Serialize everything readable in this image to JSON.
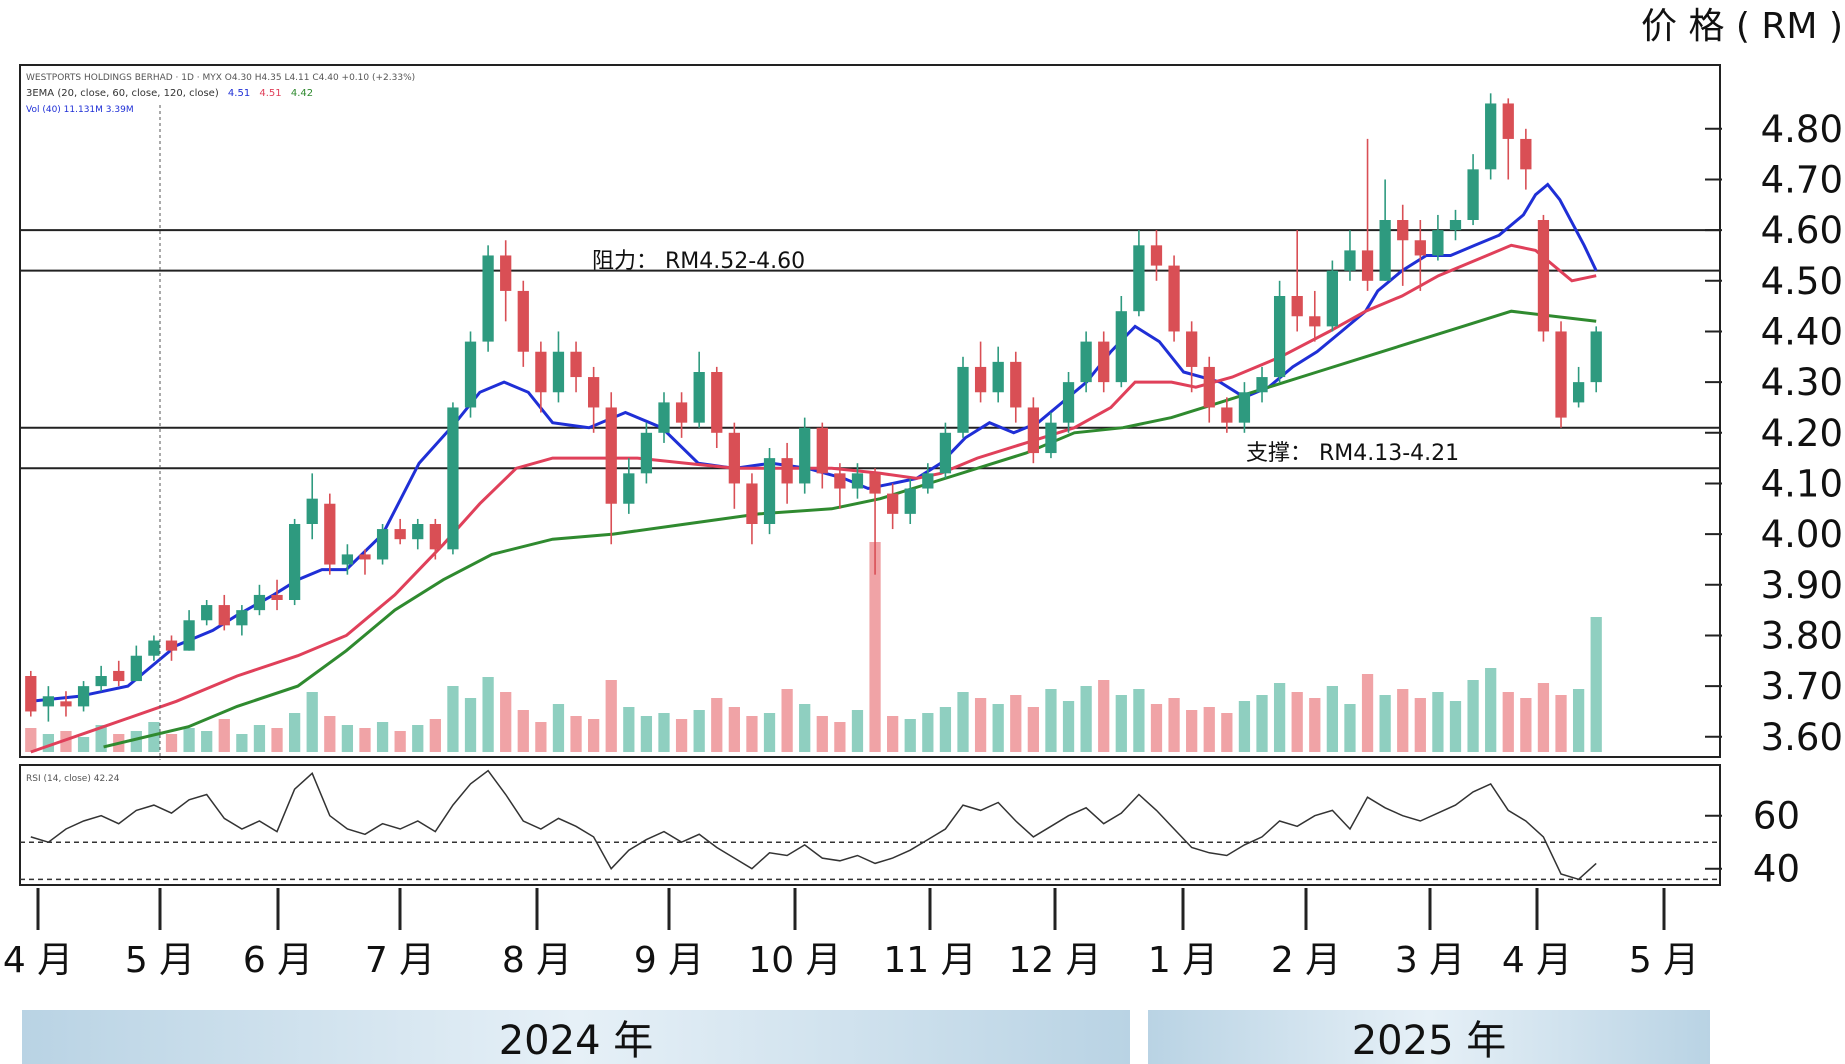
{
  "chart_data": {
    "type": "candlestick",
    "y_axis_title": "价 格 ( RM )",
    "price_ticks": [
      "4.80",
      "4.70",
      "4.60",
      "4.50",
      "4.40",
      "4.30",
      "4.20",
      "4.10",
      "4.00",
      "3.90",
      "3.80",
      "3.70",
      "3.60"
    ],
    "price_range": [
      3.57,
      4.92
    ],
    "rsi_ticks": [
      "60",
      "40"
    ],
    "rsi_range": [
      35,
      78
    ],
    "rsi_dashed_levels": [
      50,
      36
    ],
    "month_labels": [
      "4 月",
      "5 月",
      "6 月",
      "7 月",
      "8 月",
      "9 月",
      "10 月",
      "11 月",
      "12 月",
      "1 月",
      "2 月",
      "3 月",
      "4 月",
      "5 月"
    ],
    "year_bands": [
      "2024 年",
      "2025 年"
    ],
    "header_line_1": "WESTPORTS HOLDINGS BERHAD · 1D · MYX  O4.30  H4.35  L4.11  C4.40  +0.10 (+2.33%)",
    "header_line_2_prefix": "3EMA (20, close, 60, close, 120, close)",
    "header_line_2_values": [
      "4.51",
      "4.51",
      "4.42"
    ],
    "header_line_3": "Vol (40)  11.131M  3.39M",
    "rsi_header": "RSI (14, close)  42.24",
    "resistance": {
      "label": "阻力：  RM4.52-4.60",
      "low": 4.52,
      "high": 4.6
    },
    "support": {
      "label": "支撑：  RM4.13-4.21",
      "low": 4.13,
      "high": 4.21
    },
    "series": [
      {
        "role": "ema-fast",
        "color": "#1f2fd6",
        "points": [
          [
            3.67,
            0
          ],
          [
            3.68,
            20
          ],
          [
            3.7,
            40
          ],
          [
            3.74,
            50
          ],
          [
            3.78,
            60
          ],
          [
            3.81,
            75
          ],
          [
            3.84,
            85
          ],
          [
            3.88,
            100
          ],
          [
            3.91,
            110
          ],
          [
            3.93,
            120
          ],
          [
            3.93,
            130
          ],
          [
            4.0,
            145
          ],
          [
            4.14,
            160
          ],
          [
            4.22,
            175
          ],
          [
            4.28,
            185
          ],
          [
            4.3,
            195
          ],
          [
            4.28,
            205
          ],
          [
            4.22,
            215
          ],
          [
            4.21,
            230
          ],
          [
            4.24,
            245
          ],
          [
            4.21,
            260
          ],
          [
            4.14,
            275
          ],
          [
            4.13,
            290
          ],
          [
            4.14,
            305
          ],
          [
            4.13,
            320
          ],
          [
            4.11,
            335
          ],
          [
            4.09,
            345
          ],
          [
            4.1,
            355
          ],
          [
            4.11,
            365
          ],
          [
            4.14,
            375
          ],
          [
            4.19,
            385
          ],
          [
            4.22,
            395
          ],
          [
            4.2,
            405
          ],
          [
            4.22,
            415
          ],
          [
            4.26,
            425
          ],
          [
            4.3,
            435
          ],
          [
            4.36,
            445
          ],
          [
            4.41,
            455
          ],
          [
            4.38,
            465
          ],
          [
            4.32,
            475
          ],
          [
            4.3,
            490
          ],
          [
            4.27,
            500
          ],
          [
            4.29,
            510
          ],
          [
            4.33,
            520
          ],
          [
            4.36,
            530
          ],
          [
            4.4,
            540
          ],
          [
            4.44,
            550
          ],
          [
            4.48,
            555
          ],
          [
            4.52,
            565
          ],
          [
            4.55,
            575
          ],
          [
            4.55,
            585
          ],
          [
            4.57,
            595
          ],
          [
            4.59,
            605
          ],
          [
            4.63,
            615
          ],
          [
            4.67,
            620
          ],
          [
            4.69,
            625
          ],
          [
            4.66,
            630
          ],
          [
            4.57,
            640
          ],
          [
            4.52,
            645
          ]
        ]
      },
      {
        "role": "ema-mid",
        "color": "#e0405a",
        "points": [
          [
            3.57,
            0
          ],
          [
            3.62,
            30
          ],
          [
            3.67,
            60
          ],
          [
            3.72,
            85
          ],
          [
            3.76,
            110
          ],
          [
            3.8,
            130
          ],
          [
            3.88,
            150
          ],
          [
            3.98,
            170
          ],
          [
            4.06,
            185
          ],
          [
            4.13,
            200
          ],
          [
            4.15,
            215
          ],
          [
            4.15,
            230
          ],
          [
            4.15,
            250
          ],
          [
            4.14,
            270
          ],
          [
            4.13,
            290
          ],
          [
            4.13,
            310
          ],
          [
            4.13,
            330
          ],
          [
            4.12,
            350
          ],
          [
            4.11,
            365
          ],
          [
            4.12,
            375
          ],
          [
            4.15,
            390
          ],
          [
            4.18,
            410
          ],
          [
            4.21,
            430
          ],
          [
            4.25,
            445
          ],
          [
            4.3,
            455
          ],
          [
            4.3,
            470
          ],
          [
            4.29,
            480
          ],
          [
            4.31,
            495
          ],
          [
            4.35,
            515
          ],
          [
            4.4,
            535
          ],
          [
            4.44,
            550
          ],
          [
            4.47,
            565
          ],
          [
            4.51,
            580
          ],
          [
            4.55,
            600
          ],
          [
            4.57,
            610
          ],
          [
            4.56,
            620
          ],
          [
            4.5,
            635
          ],
          [
            4.51,
            645
          ]
        ]
      },
      {
        "role": "ema-slow",
        "color": "#2f8a2f",
        "points": [
          [
            3.58,
            30
          ],
          [
            3.62,
            65
          ],
          [
            3.66,
            85
          ],
          [
            3.7,
            110
          ],
          [
            3.77,
            130
          ],
          [
            3.85,
            150
          ],
          [
            3.91,
            170
          ],
          [
            3.96,
            190
          ],
          [
            3.99,
            215
          ],
          [
            4.0,
            240
          ],
          [
            4.02,
            270
          ],
          [
            4.04,
            300
          ],
          [
            4.05,
            330
          ],
          [
            4.07,
            350
          ],
          [
            4.1,
            370
          ],
          [
            4.13,
            390
          ],
          [
            4.16,
            410
          ],
          [
            4.2,
            430
          ],
          [
            4.21,
            450
          ],
          [
            4.23,
            470
          ],
          [
            4.26,
            490
          ],
          [
            4.29,
            510
          ],
          [
            4.32,
            530
          ],
          [
            4.35,
            550
          ],
          [
            4.38,
            570
          ],
          [
            4.41,
            590
          ],
          [
            4.44,
            610
          ],
          [
            4.42,
            645
          ]
        ]
      }
    ],
    "candles": [
      {
        "o": 3.72,
        "c": 3.65,
        "h": 3.73,
        "l": 3.64
      },
      {
        "o": 3.66,
        "c": 3.68,
        "h": 3.7,
        "l": 3.63
      },
      {
        "o": 3.67,
        "c": 3.66,
        "h": 3.69,
        "l": 3.64
      },
      {
        "o": 3.66,
        "c": 3.7,
        "h": 3.71,
        "l": 3.65
      },
      {
        "o": 3.7,
        "c": 3.72,
        "h": 3.74,
        "l": 3.69
      },
      {
        "o": 3.73,
        "c": 3.71,
        "h": 3.75,
        "l": 3.7
      },
      {
        "o": 3.71,
        "c": 3.76,
        "h": 3.78,
        "l": 3.71
      },
      {
        "o": 3.76,
        "c": 3.79,
        "h": 3.8,
        "l": 3.75
      },
      {
        "o": 3.79,
        "c": 3.77,
        "h": 3.8,
        "l": 3.75
      },
      {
        "o": 3.77,
        "c": 3.83,
        "h": 3.85,
        "l": 3.77
      },
      {
        "o": 3.83,
        "c": 3.86,
        "h": 3.87,
        "l": 3.82
      },
      {
        "o": 3.86,
        "c": 3.82,
        "h": 3.88,
        "l": 3.81
      },
      {
        "o": 3.82,
        "c": 3.85,
        "h": 3.86,
        "l": 3.8
      },
      {
        "o": 3.85,
        "c": 3.88,
        "h": 3.9,
        "l": 3.84
      },
      {
        "o": 3.88,
        "c": 3.87,
        "h": 3.91,
        "l": 3.85
      },
      {
        "o": 3.87,
        "c": 4.02,
        "h": 4.03,
        "l": 3.86
      },
      {
        "o": 4.02,
        "c": 4.07,
        "h": 4.12,
        "l": 3.99
      },
      {
        "o": 4.06,
        "c": 3.94,
        "h": 4.08,
        "l": 3.92
      },
      {
        "o": 3.94,
        "c": 3.96,
        "h": 3.98,
        "l": 3.92
      },
      {
        "o": 3.96,
        "c": 3.95,
        "h": 3.97,
        "l": 3.92
      },
      {
        "o": 3.95,
        "c": 4.01,
        "h": 4.02,
        "l": 3.94
      },
      {
        "o": 4.01,
        "c": 3.99,
        "h": 4.03,
        "l": 3.98
      },
      {
        "o": 3.99,
        "c": 4.02,
        "h": 4.03,
        "l": 3.97
      },
      {
        "o": 4.02,
        "c": 3.97,
        "h": 4.03,
        "l": 3.95
      },
      {
        "o": 3.97,
        "c": 4.25,
        "h": 4.26,
        "l": 3.96
      },
      {
        "o": 4.25,
        "c": 4.38,
        "h": 4.4,
        "l": 4.23
      },
      {
        "o": 4.38,
        "c": 4.55,
        "h": 4.57,
        "l": 4.36
      },
      {
        "o": 4.55,
        "c": 4.48,
        "h": 4.58,
        "l": 4.42
      },
      {
        "o": 4.48,
        "c": 4.36,
        "h": 4.5,
        "l": 4.33
      },
      {
        "o": 4.36,
        "c": 4.28,
        "h": 4.38,
        "l": 4.24
      },
      {
        "o": 4.28,
        "c": 4.36,
        "h": 4.4,
        "l": 4.26
      },
      {
        "o": 4.36,
        "c": 4.31,
        "h": 4.38,
        "l": 4.28
      },
      {
        "o": 4.31,
        "c": 4.25,
        "h": 4.33,
        "l": 4.2
      },
      {
        "o": 4.25,
        "c": 4.06,
        "h": 4.28,
        "l": 3.98
      },
      {
        "o": 4.06,
        "c": 4.12,
        "h": 4.15,
        "l": 4.04
      },
      {
        "o": 4.12,
        "c": 4.2,
        "h": 4.22,
        "l": 4.1
      },
      {
        "o": 4.2,
        "c": 4.26,
        "h": 4.28,
        "l": 4.18
      },
      {
        "o": 4.26,
        "c": 4.22,
        "h": 4.28,
        "l": 4.19
      },
      {
        "o": 4.22,
        "c": 4.32,
        "h": 4.36,
        "l": 4.21
      },
      {
        "o": 4.32,
        "c": 4.2,
        "h": 4.33,
        "l": 4.17
      },
      {
        "o": 4.2,
        "c": 4.1,
        "h": 4.22,
        "l": 4.05
      },
      {
        "o": 4.1,
        "c": 4.02,
        "h": 4.12,
        "l": 3.98
      },
      {
        "o": 4.02,
        "c": 4.15,
        "h": 4.17,
        "l": 4.0
      },
      {
        "o": 4.15,
        "c": 4.1,
        "h": 4.18,
        "l": 4.06
      },
      {
        "o": 4.1,
        "c": 4.21,
        "h": 4.23,
        "l": 4.08
      },
      {
        "o": 4.21,
        "c": 4.12,
        "h": 4.22,
        "l": 4.09
      },
      {
        "o": 4.12,
        "c": 4.09,
        "h": 4.14,
        "l": 4.05
      },
      {
        "o": 4.09,
        "c": 4.12,
        "h": 4.14,
        "l": 4.07
      },
      {
        "o": 4.12,
        "c": 4.08,
        "h": 4.13,
        "l": 3.92
      },
      {
        "o": 4.08,
        "c": 4.04,
        "h": 4.1,
        "l": 4.01
      },
      {
        "o": 4.04,
        "c": 4.09,
        "h": 4.11,
        "l": 4.02
      },
      {
        "o": 4.09,
        "c": 4.12,
        "h": 4.14,
        "l": 4.08
      },
      {
        "o": 4.12,
        "c": 4.2,
        "h": 4.22,
        "l": 4.11
      },
      {
        "o": 4.2,
        "c": 4.33,
        "h": 4.35,
        "l": 4.19
      },
      {
        "o": 4.33,
        "c": 4.28,
        "h": 4.38,
        "l": 4.26
      },
      {
        "o": 4.28,
        "c": 4.34,
        "h": 4.37,
        "l": 4.26
      },
      {
        "o": 4.34,
        "c": 4.25,
        "h": 4.36,
        "l": 4.22
      },
      {
        "o": 4.25,
        "c": 4.16,
        "h": 4.27,
        "l": 4.14
      },
      {
        "o": 4.16,
        "c": 4.22,
        "h": 4.24,
        "l": 4.15
      },
      {
        "o": 4.22,
        "c": 4.3,
        "h": 4.32,
        "l": 4.2
      },
      {
        "o": 4.3,
        "c": 4.38,
        "h": 4.4,
        "l": 4.28
      },
      {
        "o": 4.38,
        "c": 4.3,
        "h": 4.4,
        "l": 4.28
      },
      {
        "o": 4.3,
        "c": 4.44,
        "h": 4.47,
        "l": 4.29
      },
      {
        "o": 4.44,
        "c": 4.57,
        "h": 4.6,
        "l": 4.43
      },
      {
        "o": 4.57,
        "c": 4.53,
        "h": 4.6,
        "l": 4.5
      },
      {
        "o": 4.53,
        "c": 4.4,
        "h": 4.55,
        "l": 4.38
      },
      {
        "o": 4.4,
        "c": 4.33,
        "h": 4.42,
        "l": 4.28
      },
      {
        "o": 4.33,
        "c": 4.25,
        "h": 4.35,
        "l": 4.22
      },
      {
        "o": 4.25,
        "c": 4.22,
        "h": 4.27,
        "l": 4.2
      },
      {
        "o": 4.22,
        "c": 4.28,
        "h": 4.3,
        "l": 4.2
      },
      {
        "o": 4.28,
        "c": 4.31,
        "h": 4.33,
        "l": 4.26
      },
      {
        "o": 4.31,
        "c": 4.47,
        "h": 4.5,
        "l": 4.3
      },
      {
        "o": 4.47,
        "c": 4.43,
        "h": 4.6,
        "l": 4.4
      },
      {
        "o": 4.43,
        "c": 4.41,
        "h": 4.48,
        "l": 4.38
      },
      {
        "o": 4.41,
        "c": 4.52,
        "h": 4.54,
        "l": 4.4
      },
      {
        "o": 4.52,
        "c": 4.56,
        "h": 4.6,
        "l": 4.5
      },
      {
        "o": 4.56,
        "c": 4.5,
        "h": 4.78,
        "l": 4.48
      },
      {
        "o": 4.5,
        "c": 4.62,
        "h": 4.7,
        "l": 4.5
      },
      {
        "o": 4.62,
        "c": 4.58,
        "h": 4.65,
        "l": 4.49
      },
      {
        "o": 4.58,
        "c": 4.55,
        "h": 4.62,
        "l": 4.48
      },
      {
        "o": 4.55,
        "c": 4.6,
        "h": 4.63,
        "l": 4.54
      },
      {
        "o": 4.6,
        "c": 4.62,
        "h": 4.64,
        "l": 4.58
      },
      {
        "o": 4.62,
        "c": 4.72,
        "h": 4.75,
        "l": 4.61
      },
      {
        "o": 4.72,
        "c": 4.85,
        "h": 4.87,
        "l": 4.7
      },
      {
        "o": 4.85,
        "c": 4.78,
        "h": 4.86,
        "l": 4.7
      },
      {
        "o": 4.78,
        "c": 4.72,
        "h": 4.8,
        "l": 4.68
      },
      {
        "o": 4.62,
        "c": 4.4,
        "h": 4.63,
        "l": 4.38
      },
      {
        "o": 4.4,
        "c": 4.23,
        "h": 4.42,
        "l": 4.21
      },
      {
        "o": 4.26,
        "c": 4.3,
        "h": 4.33,
        "l": 4.25
      },
      {
        "o": 4.3,
        "c": 4.4,
        "h": 4.41,
        "l": 4.28
      }
    ],
    "volume": [
      0.8,
      0.6,
      0.7,
      0.5,
      0.9,
      0.6,
      0.7,
      1.0,
      0.6,
      0.8,
      0.7,
      1.1,
      0.6,
      0.9,
      0.8,
      1.3,
      2.0,
      1.2,
      0.9,
      0.8,
      1.0,
      0.7,
      0.9,
      1.1,
      2.2,
      1.8,
      2.5,
      2.0,
      1.4,
      1.0,
      1.6,
      1.2,
      1.1,
      2.4,
      1.5,
      1.2,
      1.3,
      1.1,
      1.4,
      1.8,
      1.5,
      1.2,
      1.3,
      2.1,
      1.6,
      1.2,
      1.0,
      1.4,
      7.0,
      1.2,
      1.1,
      1.3,
      1.5,
      2.0,
      1.8,
      1.6,
      1.9,
      1.5,
      2.1,
      1.7,
      2.2,
      2.4,
      1.9,
      2.1,
      1.6,
      1.8,
      1.4,
      1.5,
      1.3,
      1.7,
      1.9,
      2.3,
      2.0,
      1.8,
      2.2,
      1.6,
      2.6,
      1.9,
      2.1,
      1.8,
      2.0,
      1.7,
      2.4,
      2.8,
      2.0,
      1.8,
      2.3,
      1.9,
      2.1,
      4.5
    ],
    "rsi": [
      52,
      50,
      55,
      58,
      60,
      57,
      62,
      64,
      61,
      66,
      68,
      59,
      55,
      58,
      54,
      70,
      76,
      60,
      55,
      53,
      57,
      55,
      58,
      54,
      64,
      72,
      77,
      68,
      58,
      55,
      59,
      56,
      52,
      40,
      47,
      51,
      54,
      50,
      53,
      48,
      44,
      40,
      46,
      45,
      49,
      44,
      43,
      45,
      42,
      44,
      47,
      51,
      55,
      64,
      62,
      65,
      58,
      52,
      56,
      60,
      63,
      57,
      61,
      68,
      62,
      55,
      48,
      46,
      45,
      49,
      52,
      58,
      56,
      60,
      62,
      55,
      67,
      63,
      60,
      58,
      61,
      64,
      69,
      72,
      62,
      58,
      52,
      38,
      36,
      42
    ]
  }
}
